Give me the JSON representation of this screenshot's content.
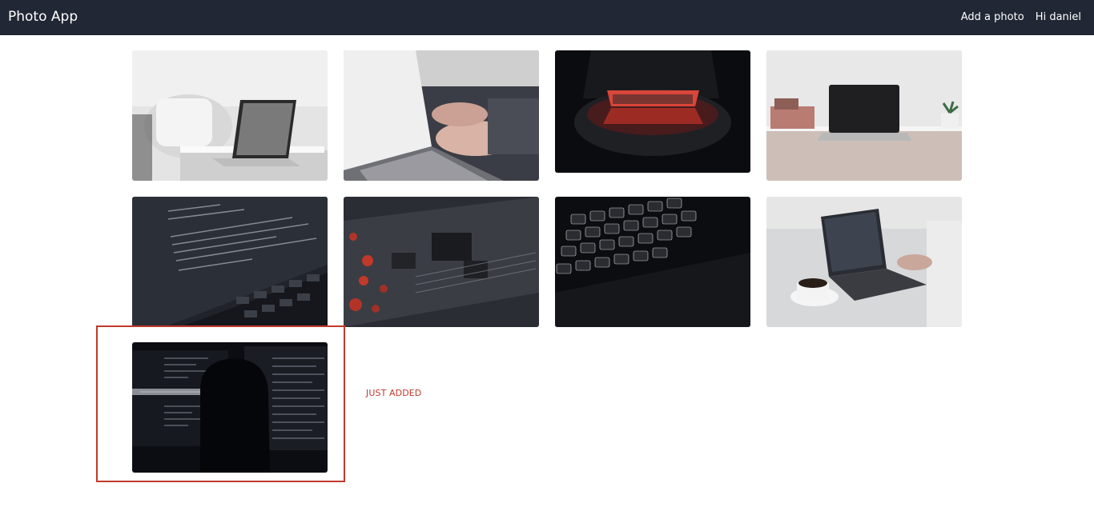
{
  "navbar": {
    "brand": "Photo App",
    "links": {
      "add_photo": "Add a photo",
      "greeting": "Hi daniel"
    },
    "background": "#212734"
  },
  "gallery": {
    "photos": [
      {
        "subject": "laptop on white sofa table"
      },
      {
        "subject": "hands typing on laptop"
      },
      {
        "subject": "laptop with red glow in dark"
      },
      {
        "subject": "laptop on desk with plant"
      },
      {
        "subject": "code on laptop screen"
      },
      {
        "subject": "circuit board"
      },
      {
        "subject": "backlit keyboard"
      },
      {
        "subject": "laptop with coffee cup"
      },
      {
        "subject": "person silhouette before code screens"
      }
    ],
    "new_photo_label": "JUST ADDED",
    "highlight_color": "#c0392b"
  }
}
